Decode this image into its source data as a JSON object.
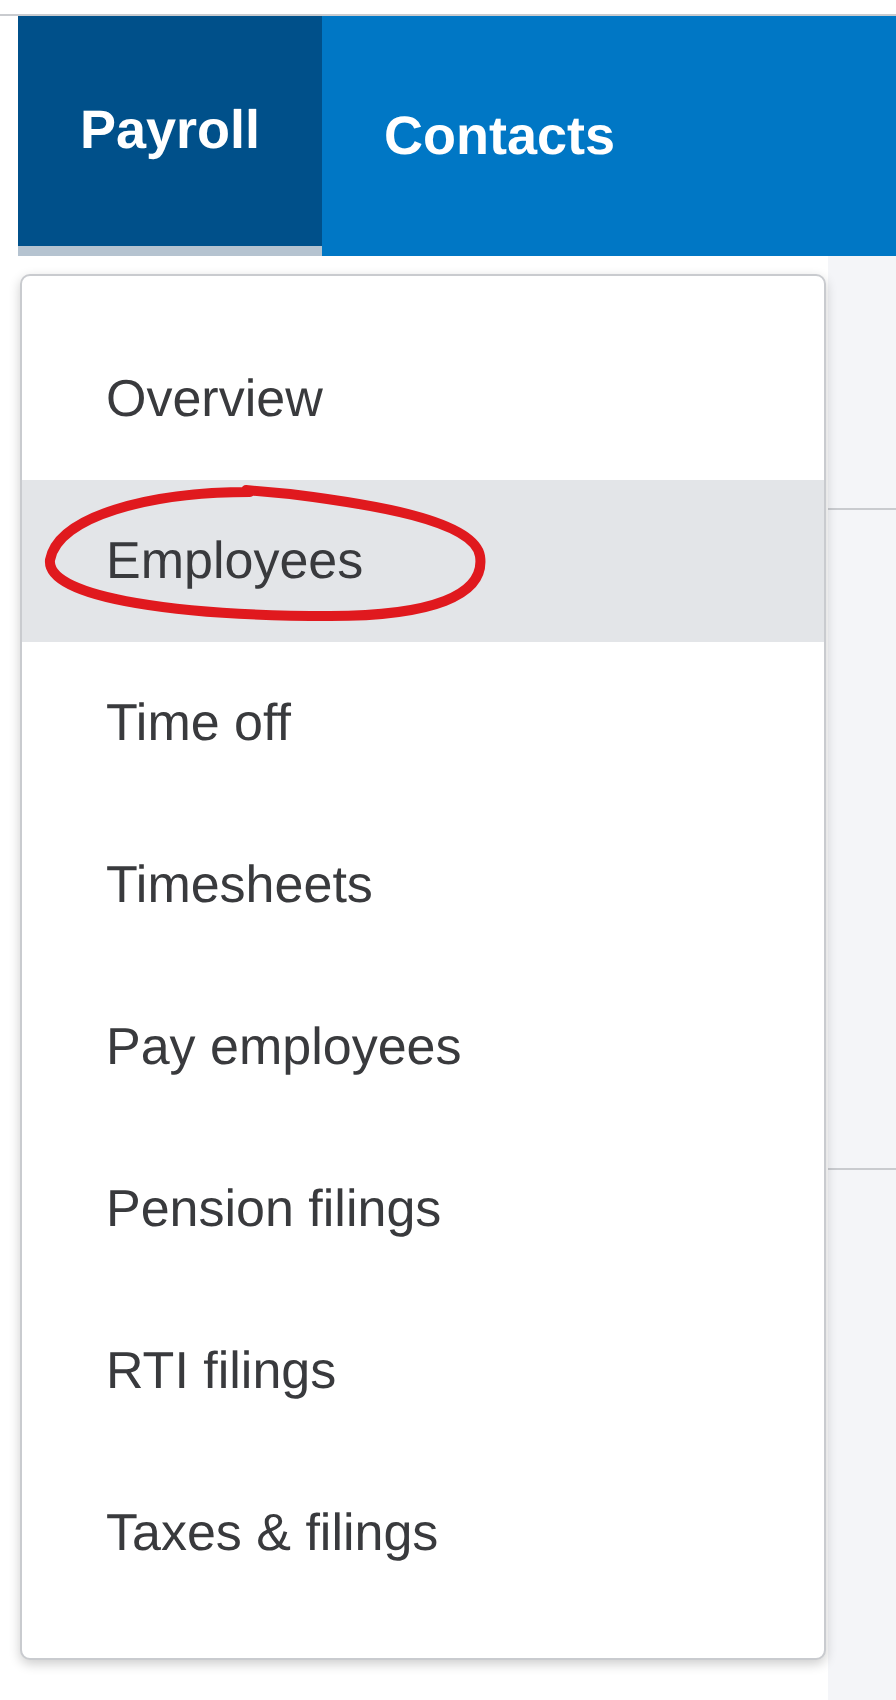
{
  "tabs": [
    {
      "label": "Payroll",
      "selected": true
    },
    {
      "label": "Contacts",
      "selected": false
    }
  ],
  "menu": {
    "items": [
      {
        "label": "Overview",
        "hovered": false,
        "circled": false
      },
      {
        "label": "Employees",
        "hovered": true,
        "circled": true
      },
      {
        "label": "Time off",
        "hovered": false,
        "circled": false
      },
      {
        "label": "Timesheets",
        "hovered": false,
        "circled": false
      },
      {
        "label": "Pay employees",
        "hovered": false,
        "circled": false
      },
      {
        "label": "Pension filings",
        "hovered": false,
        "circled": false
      },
      {
        "label": "RTI filings",
        "hovered": false,
        "circled": false
      },
      {
        "label": "Taxes & filings",
        "hovered": false,
        "circled": false
      }
    ]
  }
}
